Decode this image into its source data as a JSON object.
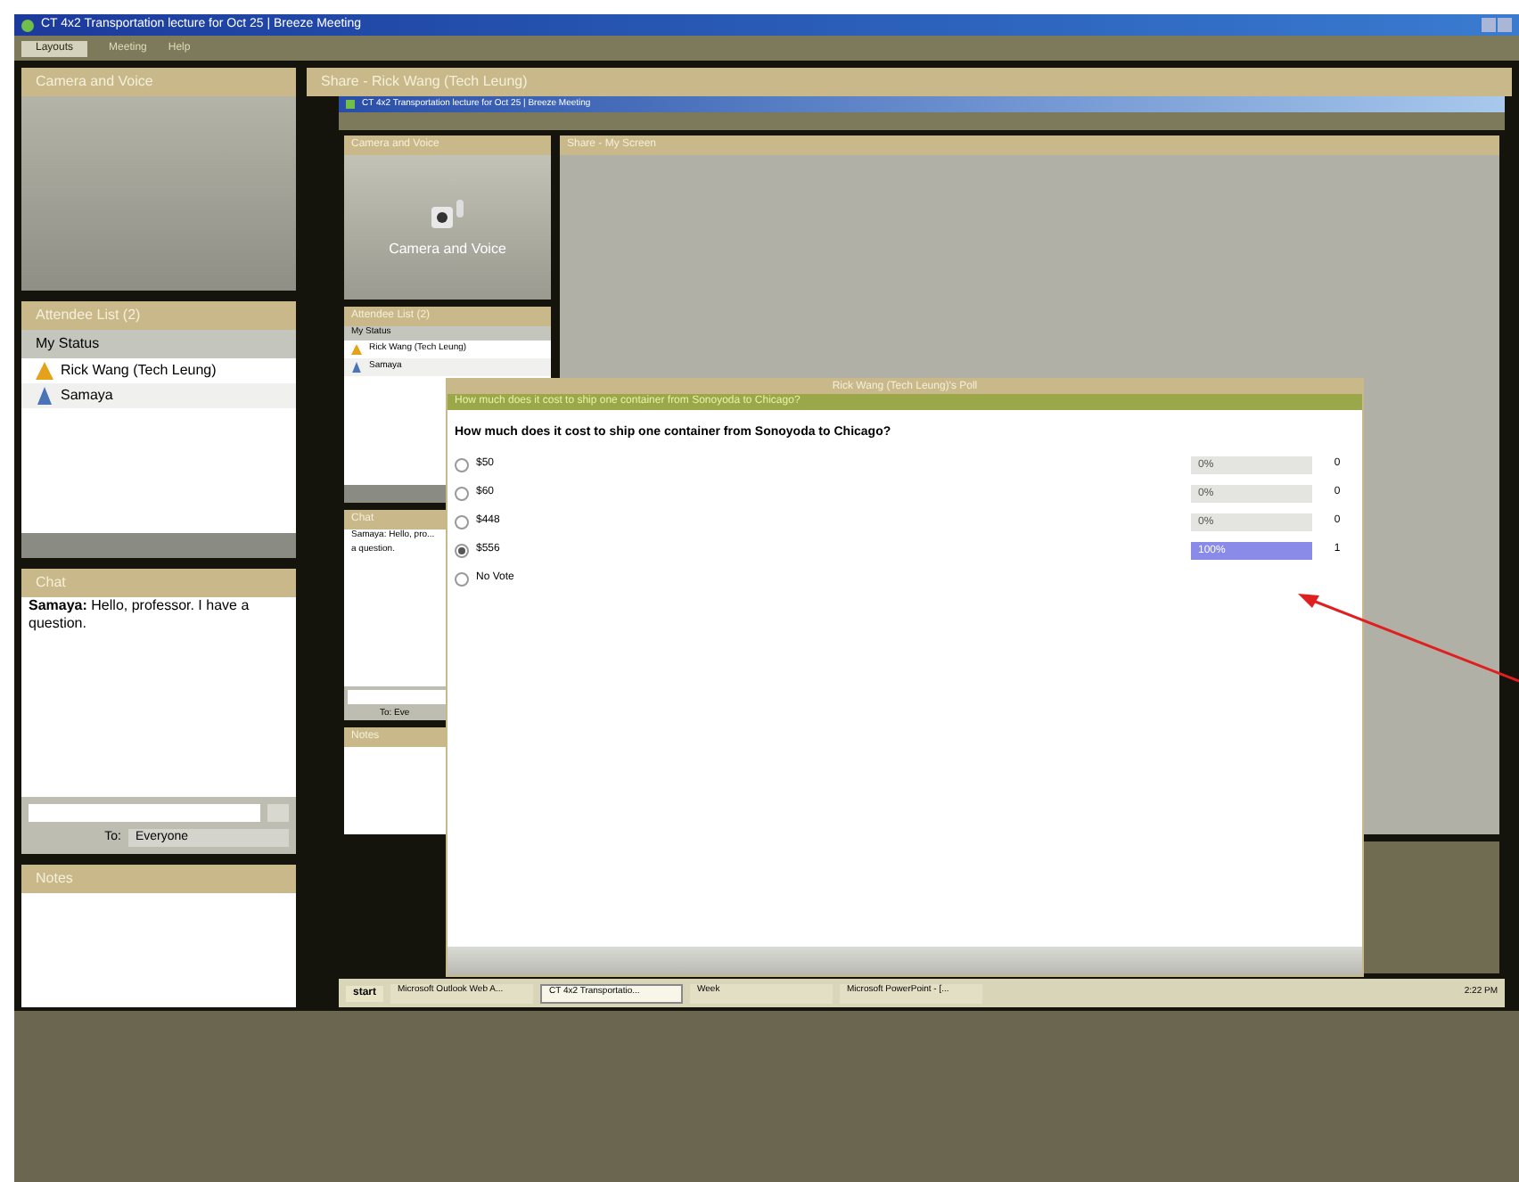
{
  "window": {
    "title": "CT 4x2 Transportation lecture for Oct 25 | Breeze Meeting"
  },
  "menu": [
    {
      "label": "Layouts",
      "selected": true
    },
    {
      "label": "Meeting",
      "selected": false
    },
    {
      "label": "Help",
      "selected": false
    }
  ],
  "left": {
    "camera_title": "Camera and Voice",
    "attendee_title": "Attendee List (2)",
    "status": "My Status",
    "attendees": [
      {
        "name": "Rick Wang (Tech Leung)",
        "kind": "host"
      },
      {
        "name": "Samaya",
        "kind": "participant"
      }
    ],
    "chat_title": "Chat",
    "messages": [
      {
        "sender": "Samaya:",
        "text": "Hello, professor. I have a question."
      }
    ],
    "to_label": "To:",
    "to_value": "Everyone",
    "notes_title": "Notes"
  },
  "share": {
    "title": "Share - Rick Wang (Tech Leung)"
  },
  "nested": {
    "title": "CT 4x2 Transportation lecture for Oct 25 | Breeze Meeting",
    "camera_title": "Camera and Voice",
    "camera_button": "Camera and Voice",
    "attendee_title": "Attendee List (2)",
    "status": "My Status",
    "attendees": [
      {
        "name": "Rick Wang (Tech Leung)",
        "kind": "host"
      },
      {
        "name": "Samaya",
        "kind": "participant"
      }
    ],
    "chat_title": "Chat",
    "chat_text": "Samaya: Hello, pro... a question.",
    "to": "To: Eve",
    "notes_title": "Notes",
    "share_title": "Share - My Screen",
    "taskbar": {
      "start": "start",
      "items": [
        {
          "label": "Microsoft Outlook Web A...",
          "selected": false
        },
        {
          "label": "CT 4x2 Transportatio...",
          "selected": true
        },
        {
          "label": "Week",
          "selected": false
        },
        {
          "label": "Microsoft PowerPoint - [...",
          "selected": false
        }
      ],
      "clock": "2:22 PM"
    }
  },
  "poll": {
    "title": "Rick Wang (Tech Leung)'s Poll",
    "header": "How much does it cost to ship one container from Sonoyoda to Chicago?",
    "question": "How much does it cost to ship one container from Sonoyoda to Chicago?",
    "options": [
      {
        "label": "$50",
        "selected": false,
        "percent": "0%",
        "count": "0",
        "level": 0
      },
      {
        "label": "$60",
        "selected": false,
        "percent": "0%",
        "count": "0",
        "level": 0
      },
      {
        "label": "$448",
        "selected": false,
        "percent": "0%",
        "count": "0",
        "level": 0
      },
      {
        "label": "$556",
        "selected": true,
        "percent": "100%",
        "count": "1",
        "level": 1
      },
      {
        "label": "No Vote",
        "selected": false
      }
    ]
  }
}
